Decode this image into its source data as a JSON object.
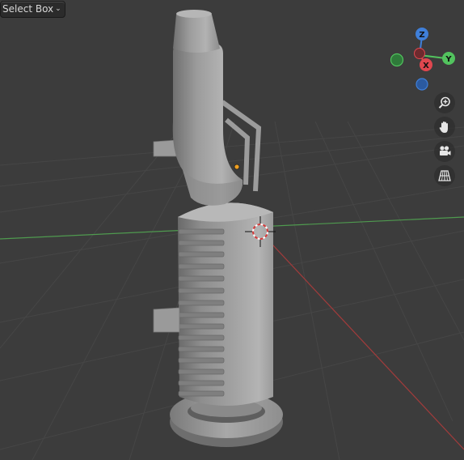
{
  "header": {
    "select_mode": "Select Box"
  },
  "gizmo": {
    "z_label": "Z",
    "y_label": "Y",
    "x_label": "X",
    "colors": {
      "x": "#e0474f",
      "y": "#52c35e",
      "z": "#3f7fd9"
    }
  },
  "nav_buttons": [
    {
      "icon": "zoom-in-icon"
    },
    {
      "icon": "hand-pan-icon"
    },
    {
      "icon": "camera-icon"
    },
    {
      "icon": "grid-ortho-icon"
    }
  ],
  "viewport": {
    "background": "#3c3c3c",
    "grid_color": "#4a4a4a",
    "x_axis_color": "#a33b3b",
    "y_axis_color": "#4f9a4f"
  }
}
